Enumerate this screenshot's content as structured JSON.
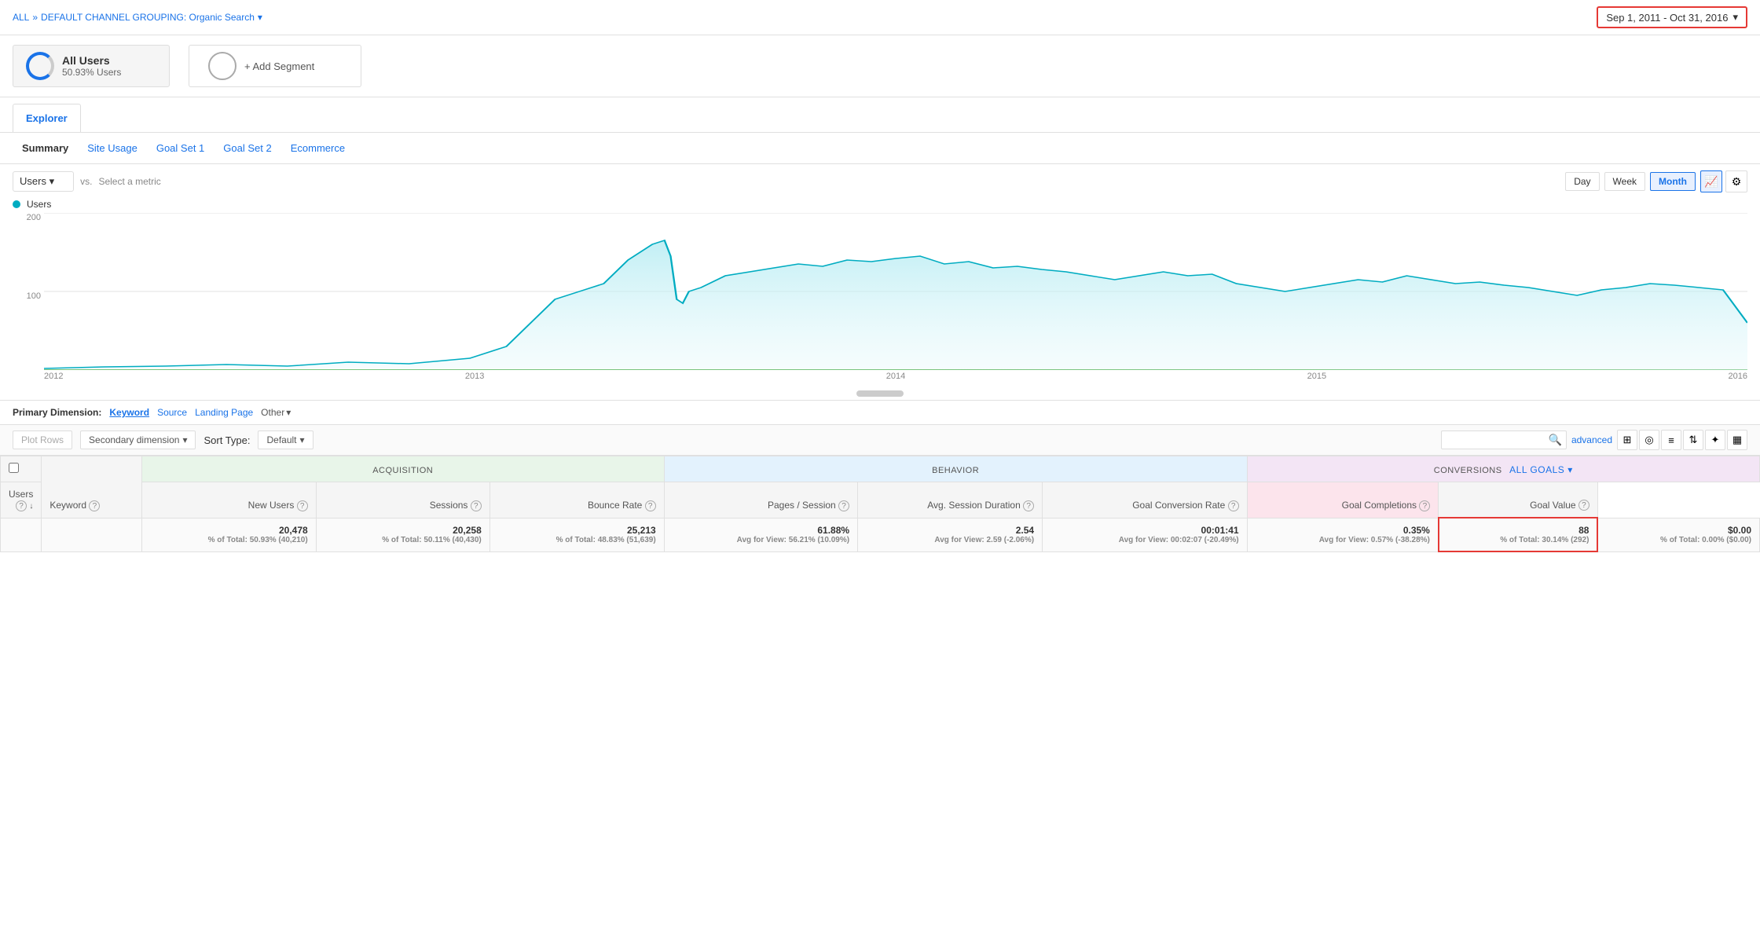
{
  "topBar": {
    "breadcrumb": {
      "all": "ALL",
      "separator": "»",
      "channel": "DEFAULT CHANNEL GROUPING: Organic Search",
      "channelDropdown": "▾"
    },
    "dateRange": "Sep 1, 2011 - Oct 31, 2016",
    "dateDropdown": "▾"
  },
  "segments": [
    {
      "name": "All Users",
      "sub": "50.93% Users",
      "type": "primary"
    }
  ],
  "addSegment": "+ Add Segment",
  "explorerTab": "Explorer",
  "subTabs": [
    {
      "label": "Summary",
      "active": true
    },
    {
      "label": "Site Usage",
      "active": false
    },
    {
      "label": "Goal Set 1",
      "active": false
    },
    {
      "label": "Goal Set 2",
      "active": false
    },
    {
      "label": "Ecommerce",
      "active": false
    }
  ],
  "chartControls": {
    "metricLabel": "Users",
    "vsLabel": "vs.",
    "selectMetric": "Select a metric",
    "timeButtons": [
      "Day",
      "Week",
      "Month"
    ],
    "activeTime": "Month",
    "chartTypes": [
      "📈",
      "⚙"
    ]
  },
  "chart": {
    "yMax": "200",
    "y100": "100",
    "xLabels": [
      "2012",
      "2013",
      "2014",
      "2015",
      "2016"
    ],
    "legendLabel": "Users"
  },
  "primaryDimension": {
    "label": "Primary Dimension:",
    "options": [
      "Keyword",
      "Source",
      "Landing Page",
      "Other"
    ],
    "active": "Keyword"
  },
  "tableControls": {
    "plotRowsLabel": "Plot Rows",
    "secondaryDimLabel": "Secondary dimension",
    "sortTypeLabel": "Sort Type:",
    "sortDefault": "Default",
    "searchPlaceholder": "",
    "advancedLabel": "advanced"
  },
  "tableHeaders": {
    "keyword": "Keyword",
    "acquisitionGroup": "Acquisition",
    "behaviorGroup": "Behavior",
    "conversionsGroup": "Conversions",
    "allGoals": "All Goals",
    "users": "Users",
    "newUsers": "New Users",
    "sessions": "Sessions",
    "bounceRate": "Bounce Rate",
    "pagesPerSession": "Pages / Session",
    "avgSessionDuration": "Avg. Session Duration",
    "goalConversionRate": "Goal Conversion Rate",
    "goalCompletions": "Goal Completions",
    "goalValue": "Goal Value"
  },
  "tableTotals": {
    "users": "20,478",
    "usersPct": "% of Total: 50.93% (40,210)",
    "newUsers": "20,258",
    "newUsersPct": "% of Total: 50.11% (40,430)",
    "sessions": "25,213",
    "sessionsPct": "% of Total: 48.83% (51,639)",
    "bounceRate": "61.88%",
    "bounceRateAvg": "Avg for View: 56.21% (10.09%)",
    "pagesPerSession": "2.54",
    "pagesAvg": "Avg for View: 2.59 (-2.06%)",
    "avgSessionDuration": "00:01:41",
    "durationAvg": "Avg for View: 00:02:07 (-20.49%)",
    "goalConversionRate": "0.35%",
    "convRateAvg": "Avg for View: 0.57% (-38.28%)",
    "goalCompletions": "88",
    "completionsPct": "% of Total: 30.14% (292)",
    "goalValue": "$0.00",
    "goalValuePct": "% of Total: 0.00% ($0.00)"
  }
}
